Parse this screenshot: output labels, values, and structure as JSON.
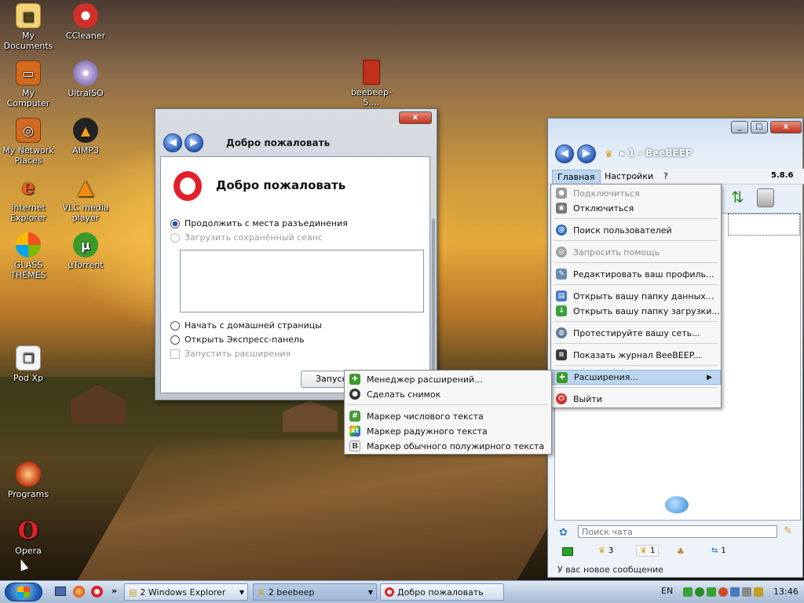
{
  "desktop": {
    "icons": [
      {
        "label": "My Documents",
        "icon": "folder-icon"
      },
      {
        "label": "CCleaner",
        "icon": "ccleaner-icon"
      },
      {
        "label": "My Computer",
        "icon": "computer-icon"
      },
      {
        "label": "UltraISO",
        "icon": "disc-icon"
      },
      {
        "label": "My Network Places",
        "icon": "network-icon"
      },
      {
        "label": "AIMP3",
        "icon": "aimp-icon"
      },
      {
        "label": "Internet Explorer",
        "icon": "ie-icon"
      },
      {
        "label": "VLC media player",
        "icon": "vlc-icon"
      },
      {
        "label": "GLASS THEMES",
        "icon": "glass-icon"
      },
      {
        "label": "µTorrent",
        "icon": "utorrent-icon"
      },
      {
        "label": "beebeep-5....",
        "icon": "archive-icon"
      },
      {
        "label": "Pod Xp",
        "icon": "podxp-icon"
      },
      {
        "label": "Programs",
        "icon": "programs-icon"
      },
      {
        "label": "Opera",
        "icon": "opera-icon"
      }
    ]
  },
  "opera_dialog": {
    "title": "Добро пожаловать",
    "heading": "Добро пожаловать",
    "close_label": "x",
    "options": [
      {
        "label": "Продолжить с места разъединения",
        "checked": true,
        "disabled": false
      },
      {
        "label": "Загрузить сохранённый сеанс",
        "checked": false,
        "disabled": true
      },
      {
        "label": "Начать с домашней страницы",
        "checked": false,
        "disabled": false
      },
      {
        "label": "Открыть Экспресс-панель",
        "checked": false,
        "disabled": false
      }
    ],
    "extensions_checkbox": "Запустить расширения",
    "start_button": "Запуск"
  },
  "extensions_submenu": {
    "items": [
      {
        "label": "Менеджер расширений...",
        "icon": "puzzle-icon"
      },
      {
        "label": "Сделать снимок",
        "icon": "camera-icon"
      },
      {
        "label": "Маркер числового текста",
        "icon": "hash-icon"
      },
      {
        "label": "Маркер радужного текста",
        "icon": "rainbow-icon"
      },
      {
        "label": "Маркер обычного полужирного текста",
        "icon": "bold-icon"
      }
    ]
  },
  "beebeep": {
    "title": "1 - BeeBEEP",
    "version": "5.8.6",
    "menubar": [
      "Главная",
      "Настройки",
      "?"
    ],
    "main_menu": [
      {
        "label": "Подключиться",
        "disabled": true,
        "icon": "connect-icon"
      },
      {
        "label": "Отключиться",
        "disabled": false,
        "icon": "disconnect-icon"
      },
      {
        "label": "Поиск пользователей",
        "disabled": false,
        "icon": "search-users-icon"
      },
      {
        "label": "Запросить помощь",
        "disabled": true,
        "icon": "help-icon"
      },
      {
        "label": "Редактировать ваш профиль...",
        "disabled": false,
        "icon": "profile-icon"
      },
      {
        "label": "Открыть вашу папку данных...",
        "disabled": false,
        "icon": "data-folder-icon"
      },
      {
        "label": "Открыть вашу папку загрузки...",
        "disabled": false,
        "icon": "download-folder-icon"
      },
      {
        "label": "Протестируйте вашу сеть...",
        "disabled": false,
        "icon": "network-test-icon"
      },
      {
        "label": "Показать журнал BeeBEEP...",
        "disabled": false,
        "icon": "log-icon"
      },
      {
        "label": "Расширения...",
        "disabled": false,
        "icon": "extensions-icon"
      },
      {
        "label": "Выйти",
        "disabled": false,
        "icon": "exit-icon"
      }
    ],
    "search_placeholder": "Поиск чата",
    "status_counts": [
      "3",
      "1",
      "1"
    ],
    "status_message": "У вас новое сообщение"
  },
  "taskbar": {
    "explorer": "2 Windows Explorer",
    "beebeep": "2 beebeep",
    "opera": "Добро пожаловать",
    "lang": "EN",
    "time": "13:46"
  }
}
